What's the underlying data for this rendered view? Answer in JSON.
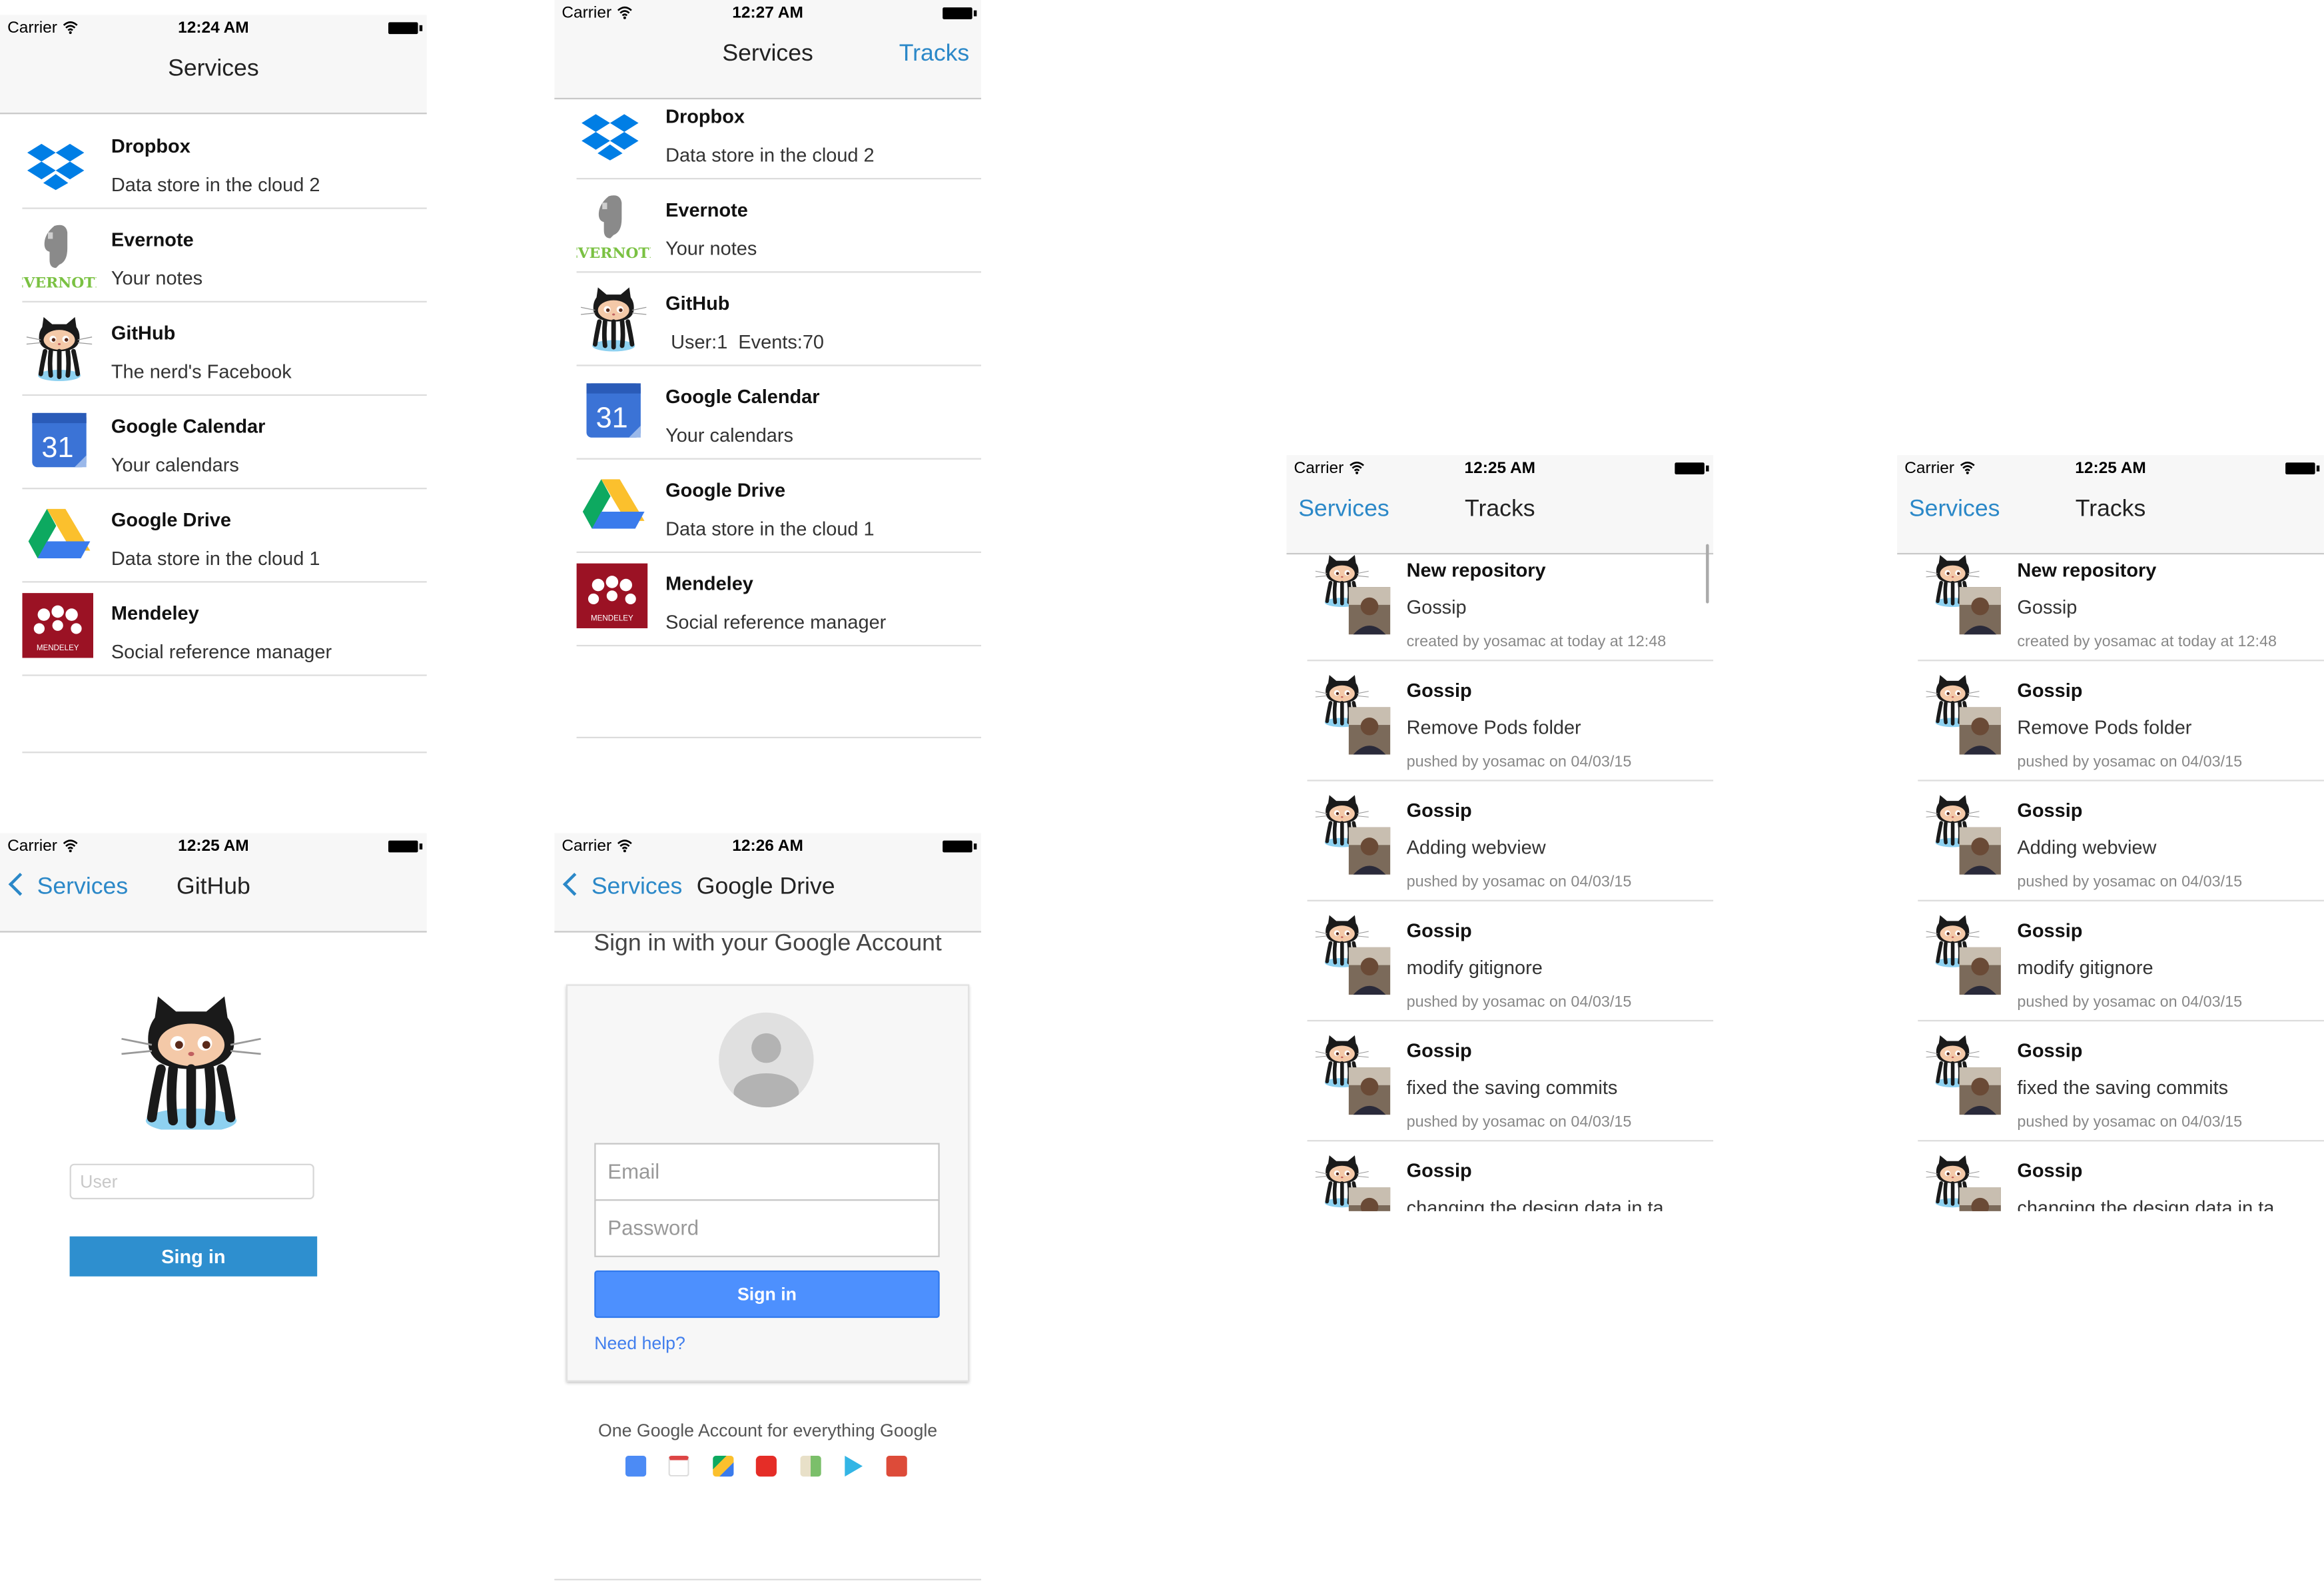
{
  "status": {
    "carrier": "Carrier"
  },
  "services_screen_1": {
    "time": "12:24 AM",
    "title": "Services",
    "items": [
      {
        "name": "Dropbox",
        "desc": "Data store in the cloud 2",
        "icon": "dropbox-icon"
      },
      {
        "name": "Evernote",
        "desc": "Your notes",
        "icon": "evernote-icon"
      },
      {
        "name": "GitHub",
        "desc": "The nerd's Facebook",
        "icon": "github-octocat-icon"
      },
      {
        "name": "Google Calendar",
        "desc": "Your calendars",
        "icon": "google-calendar-icon"
      },
      {
        "name": "Google Drive",
        "desc": "Data store in the cloud 1",
        "icon": "google-drive-icon"
      },
      {
        "name": "Mendeley",
        "desc": "Social reference manager",
        "icon": "mendeley-icon"
      }
    ]
  },
  "services_screen_2": {
    "time": "12:27 AM",
    "title": "Services",
    "right_button": "Tracks",
    "items": [
      {
        "name": "Dropbox",
        "desc": "Data store in the cloud 2"
      },
      {
        "name": "Evernote",
        "desc": "Your notes"
      },
      {
        "name": "GitHub",
        "desc": " User:1  Events:70"
      },
      {
        "name": "Google Calendar",
        "desc": "Your calendars"
      },
      {
        "name": "Google Drive",
        "desc": "Data store in the cloud 1"
      },
      {
        "name": "Mendeley",
        "desc": "Social reference manager"
      }
    ]
  },
  "github_screen": {
    "time": "12:25 AM",
    "back": "Services",
    "title": "GitHub",
    "user_placeholder": "User",
    "signin": "Sing in"
  },
  "google_screen": {
    "time": "12:26 AM",
    "back": "Services",
    "title": "Google Drive",
    "heading": "Sign in with your Google Account",
    "email_placeholder": "Email",
    "password_placeholder": "Password",
    "signin": "Sign in",
    "help": "Need help?",
    "footer": "One Google Account for everything Google",
    "product_icons": [
      "google-search-icon",
      "gmail-icon",
      "drive-icon",
      "youtube-icon",
      "maps-icon",
      "play-icon",
      "google-plus-icon"
    ]
  },
  "tracks_screen": {
    "time": "12:25 AM",
    "back": "Services",
    "title": "Tracks",
    "items": [
      {
        "title": "New repository",
        "msg": "Gossip",
        "meta": "created by yosamac at today at 12:48"
      },
      {
        "title": "Gossip",
        "msg": "Remove Pods folder",
        "meta": "pushed by yosamac on 04/03/15"
      },
      {
        "title": "Gossip",
        "msg": "Adding webview",
        "meta": "pushed by yosamac on 04/03/15"
      },
      {
        "title": "Gossip",
        "msg": "modify gitignore",
        "meta": "pushed by yosamac on 04/03/15"
      },
      {
        "title": "Gossip",
        "msg": "fixed the saving commits",
        "meta": "pushed by yosamac on 04/03/15"
      },
      {
        "title": "Gossip",
        "msg": "changing the design data in ta...",
        "meta": ""
      }
    ]
  },
  "colors": {
    "ios_blue": "#2b88c8",
    "google_blue": "#4d90fe",
    "github_button": "#2e8fcf"
  }
}
